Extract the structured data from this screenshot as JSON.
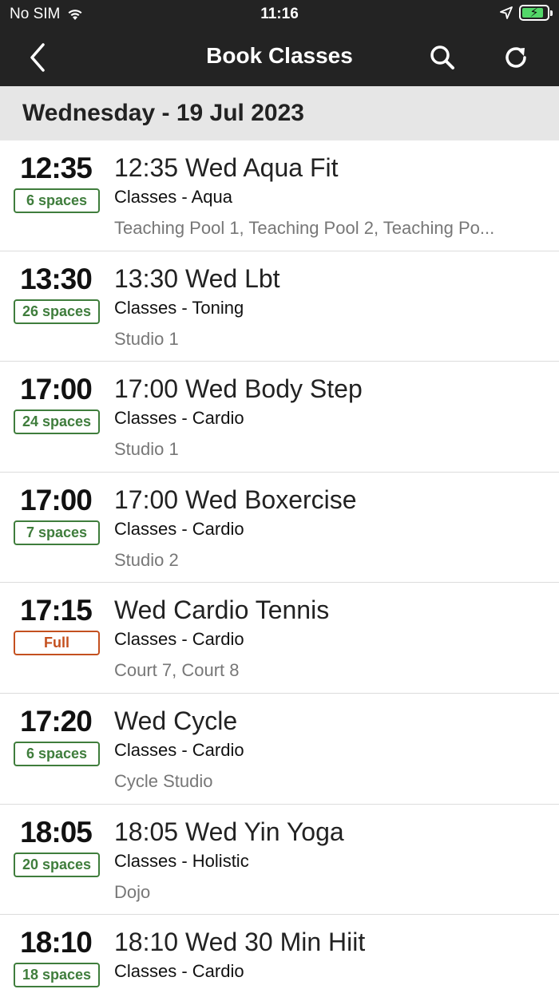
{
  "status_bar": {
    "carrier": "No SIM",
    "time": "11:16"
  },
  "nav": {
    "title": "Book Classes",
    "icons": {
      "back": "chevron-left-icon",
      "search": "search-icon",
      "refresh": "refresh-icon"
    }
  },
  "date_header": "Wednesday - 19 Jul 2023",
  "colors": {
    "bar_background": "#232323",
    "available": "#3f7d3c",
    "full": "#c4501f",
    "battery": "#53d769"
  },
  "classes": [
    {
      "time": "12:35",
      "availability": "6 spaces",
      "status": "available",
      "name": "12:35 Wed Aqua Fit",
      "category": "Classes - Aqua",
      "location": "Teaching Pool 1, Teaching Pool 2, Teaching Po..."
    },
    {
      "time": "13:30",
      "availability": "26 spaces",
      "status": "available",
      "name": "13:30 Wed Lbt",
      "category": "Classes - Toning",
      "location": "Studio 1"
    },
    {
      "time": "17:00",
      "availability": "24 spaces",
      "status": "available",
      "name": "17:00 Wed Body Step",
      "category": "Classes - Cardio",
      "location": "Studio 1"
    },
    {
      "time": "17:00",
      "availability": "7 spaces",
      "status": "available",
      "name": "17:00 Wed Boxercise",
      "category": "Classes - Cardio",
      "location": "Studio 2"
    },
    {
      "time": "17:15",
      "availability": "Full",
      "status": "full",
      "name": "Wed Cardio Tennis",
      "category": "Classes - Cardio",
      "location": "Court 7, Court 8"
    },
    {
      "time": "17:20",
      "availability": "6 spaces",
      "status": "available",
      "name": "Wed Cycle",
      "category": "Classes - Cardio",
      "location": "Cycle Studio"
    },
    {
      "time": "18:05",
      "availability": "20 spaces",
      "status": "available",
      "name": "18:05 Wed Yin Yoga",
      "category": "Classes - Holistic",
      "location": "Dojo"
    },
    {
      "time": "18:10",
      "availability": "18 spaces",
      "status": "available",
      "name": "18:10 Wed 30 Min Hiit",
      "category": "Classes - Cardio",
      "location": ""
    }
  ]
}
